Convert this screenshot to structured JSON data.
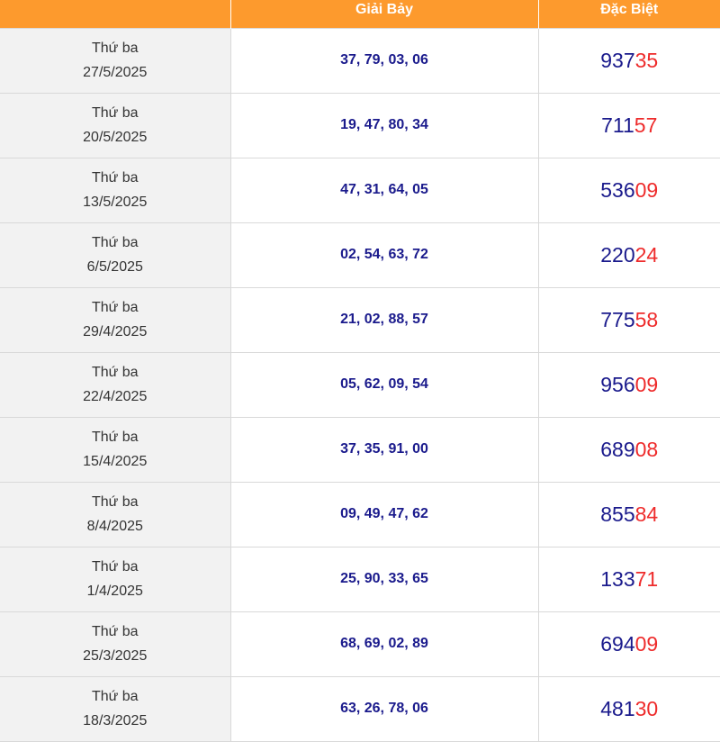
{
  "header": {
    "col_date": "",
    "col_prize7": "Giải Bảy",
    "col_special": "Đặc Biệt"
  },
  "colors": {
    "header_bg": "#fd9a2d",
    "number_blue": "#1a1a8c",
    "tail_red": "#ee2b2b"
  },
  "rows": [
    {
      "weekday": "Thứ ba",
      "date": "27/5/2025",
      "prize7": "37, 79, 03, 06",
      "special_head": "937",
      "special_tail": "35"
    },
    {
      "weekday": "Thứ ba",
      "date": "20/5/2025",
      "prize7": "19, 47, 80, 34",
      "special_head": "711",
      "special_tail": "57"
    },
    {
      "weekday": "Thứ ba",
      "date": "13/5/2025",
      "prize7": "47, 31, 64, 05",
      "special_head": "536",
      "special_tail": "09"
    },
    {
      "weekday": "Thứ ba",
      "date": "6/5/2025",
      "prize7": "02, 54, 63, 72",
      "special_head": "220",
      "special_tail": "24"
    },
    {
      "weekday": "Thứ ba",
      "date": "29/4/2025",
      "prize7": "21, 02, 88, 57",
      "special_head": "775",
      "special_tail": "58"
    },
    {
      "weekday": "Thứ ba",
      "date": "22/4/2025",
      "prize7": "05, 62, 09, 54",
      "special_head": "956",
      "special_tail": "09"
    },
    {
      "weekday": "Thứ ba",
      "date": "15/4/2025",
      "prize7": "37, 35, 91, 00",
      "special_head": "689",
      "special_tail": "08"
    },
    {
      "weekday": "Thứ ba",
      "date": "8/4/2025",
      "prize7": "09, 49, 47, 62",
      "special_head": "855",
      "special_tail": "84"
    },
    {
      "weekday": "Thứ ba",
      "date": "1/4/2025",
      "prize7": "25, 90, 33, 65",
      "special_head": "133",
      "special_tail": "71"
    },
    {
      "weekday": "Thứ ba",
      "date": "25/3/2025",
      "prize7": "68, 69, 02, 89",
      "special_head": "694",
      "special_tail": "09"
    },
    {
      "weekday": "Thứ ba",
      "date": "18/3/2025",
      "prize7": "63, 26, 78, 06",
      "special_head": "481",
      "special_tail": "30"
    }
  ]
}
